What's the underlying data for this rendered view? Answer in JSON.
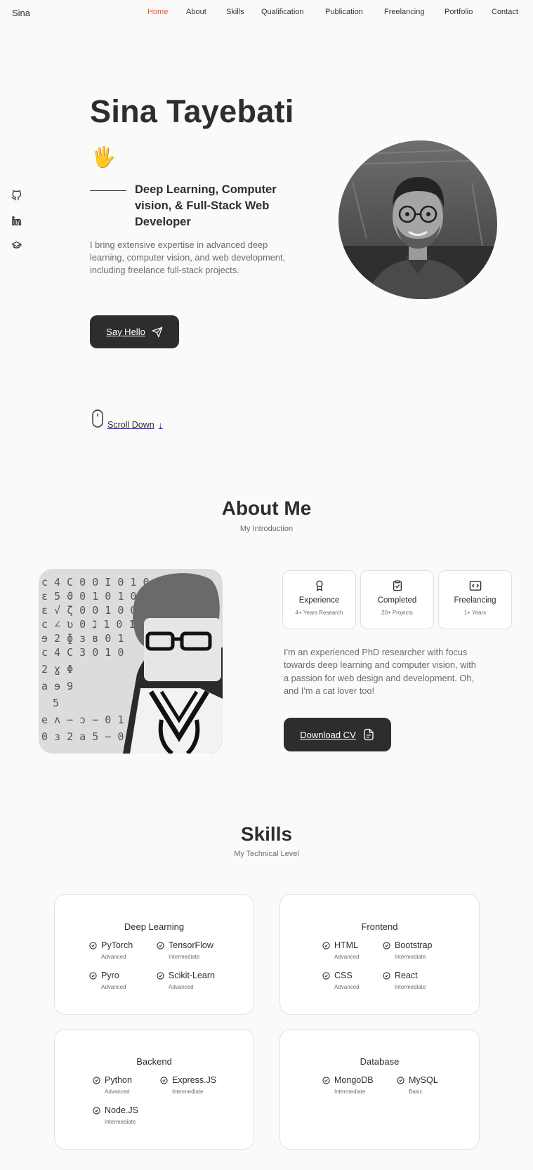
{
  "header": {
    "logo": "Sina",
    "nav": [
      "Home",
      "About",
      "Skills",
      "Qualification",
      "Publication",
      "Freelancing",
      "Portfolio",
      "Contact"
    ],
    "active": "Home",
    "accent_color": "#e4572e"
  },
  "social": {
    "icons": [
      "github-icon",
      "linkedin-icon",
      "graduation-cap-icon"
    ]
  },
  "hero": {
    "title": "Sina Tayebati",
    "wave": "🖐",
    "subtitle": "Deep Learning, Computer vision, & Full-Stack Web Developer",
    "description": "I bring extensive expertise in advanced deep learning, computer vision, and web development, including freelance full-stack projects.",
    "button": "Say Hello",
    "scroll": "Scroll Down"
  },
  "about": {
    "title": "About Me",
    "subtitle": "My Introduction",
    "boxes": [
      {
        "icon": "award-icon",
        "title": "Experience",
        "sub": "4+ Years Research"
      },
      {
        "icon": "clipboard-check-icon",
        "title": "Completed",
        "sub": "20+ Projects"
      },
      {
        "icon": "code-icon",
        "title": "Freelancing",
        "sub": "1+ Years"
      }
    ],
    "text": "I'm an experienced PhD researcher with focus towards deep learning and computer vision, with a passion for web design and development. Oh, and I'm a cat lover too!",
    "button": "Download CV"
  },
  "skills": {
    "title": "Skills",
    "subtitle": "My Technical Level",
    "cards": [
      {
        "title": "Deep Learning",
        "items": [
          {
            "name": "PyTorch",
            "level": "Advanced"
          },
          {
            "name": "TensorFlow",
            "level": "Intermediate"
          },
          {
            "name": "Pyro",
            "level": "Advanced"
          },
          {
            "name": "Scikit-Learn",
            "level": "Advanced"
          }
        ]
      },
      {
        "title": "Frontend",
        "items": [
          {
            "name": "HTML",
            "level": "Advanced"
          },
          {
            "name": "Bootstrap",
            "level": "Intermediate"
          },
          {
            "name": "CSS",
            "level": "Advanced"
          },
          {
            "name": "React",
            "level": "Intermediate"
          }
        ]
      },
      {
        "title": "Backend",
        "items": [
          {
            "name": "Python",
            "level": "Advanced"
          },
          {
            "name": "Express.JS",
            "level": "Intermediate"
          },
          {
            "name": "Node.JS",
            "level": "Intermediate"
          }
        ]
      },
      {
        "title": "Database",
        "items": [
          {
            "name": "MongoDB",
            "level": "Intermediate"
          },
          {
            "name": "MySQL",
            "level": "Basic"
          }
        ]
      }
    ]
  }
}
